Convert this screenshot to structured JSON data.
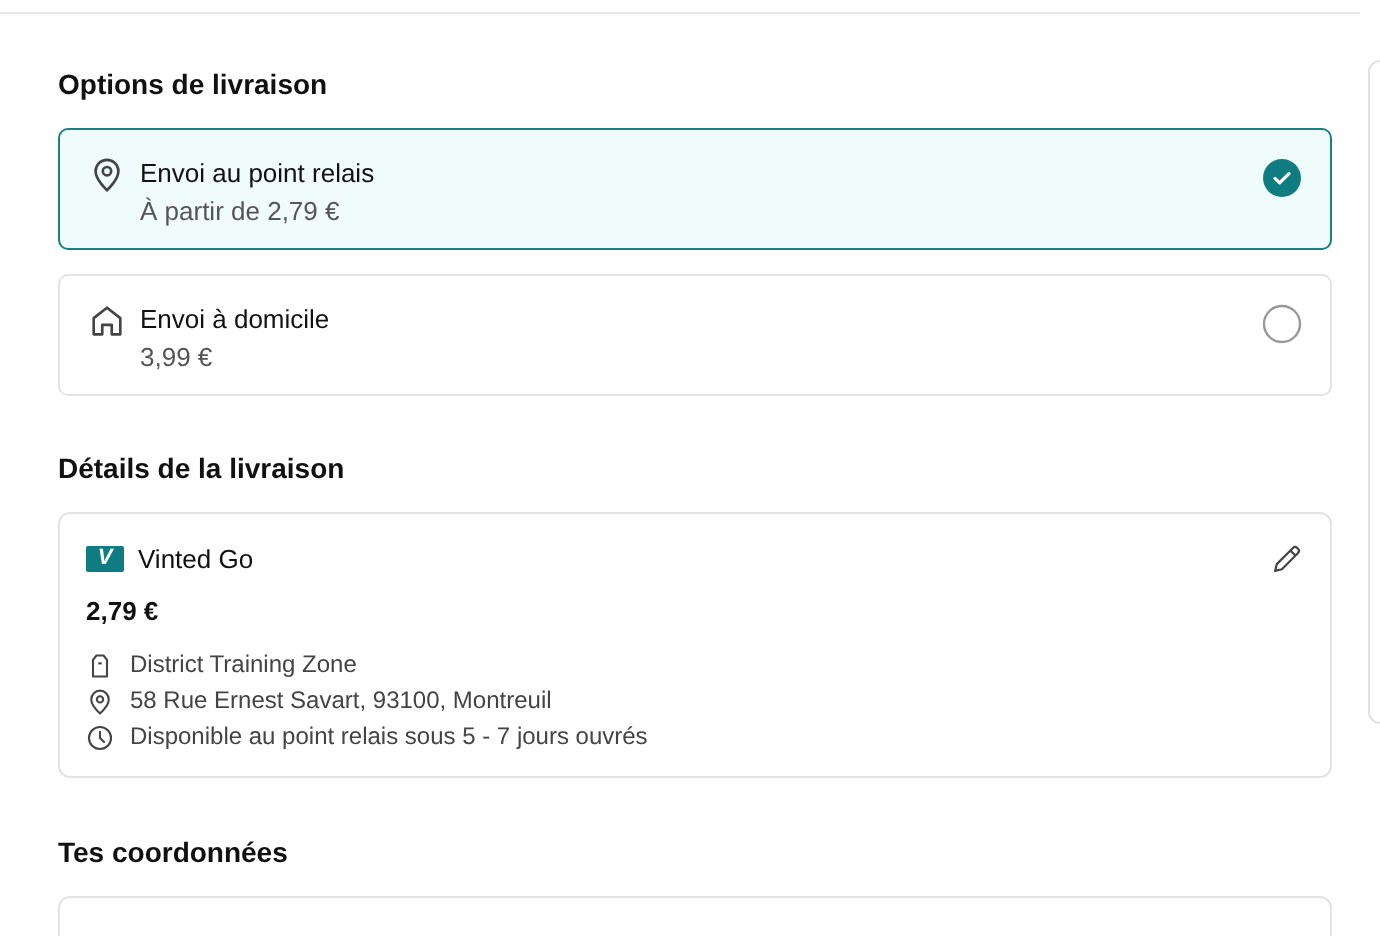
{
  "delivery_options": {
    "title": "Options de livraison",
    "options": [
      {
        "kind": "relay",
        "label": "Envoi au point relais",
        "price": "À partir de 2,79 €",
        "selected": true
      },
      {
        "kind": "home",
        "label": "Envoi à domicile",
        "price": "3,99 €",
        "selected": false
      }
    ]
  },
  "delivery_details": {
    "title": "Détails de la livraison",
    "carrier_logo": "V",
    "carrier": "Vinted Go",
    "price": "2,79 €",
    "lines": [
      {
        "kind": "locker",
        "text": "District Training Zone"
      },
      {
        "kind": "address",
        "text": "58 Rue Ernest Savart, 93100, Montreuil"
      },
      {
        "kind": "delay",
        "text": "Disponible au point relais sous 5 - 7 jours ouvrés"
      }
    ]
  },
  "contact": {
    "title": "Tes coordonnées"
  }
}
